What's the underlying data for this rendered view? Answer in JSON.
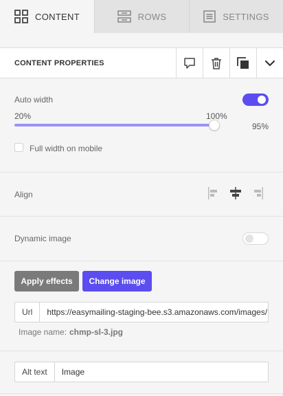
{
  "tabs": [
    {
      "label": "CONTENT",
      "icon": "grid-icon",
      "active": true
    },
    {
      "label": "ROWS",
      "icon": "rows-icon",
      "active": false
    },
    {
      "label": "SETTINGS",
      "icon": "settings-list-icon",
      "active": false
    }
  ],
  "header": {
    "title": "CONTENT PROPERTIES",
    "actions": [
      "comment-icon",
      "trash-icon",
      "duplicate-icon",
      "chevron-down-icon"
    ]
  },
  "auto_width": {
    "label": "Auto width",
    "enabled": true,
    "slider_min": "20%",
    "slider_max": "100%",
    "current": "95%",
    "slider_fraction": 0.95
  },
  "full_width_mobile": {
    "label": "Full width on mobile",
    "checked": false
  },
  "align": {
    "label": "Align",
    "options": [
      "align-left-icon",
      "align-center-icon",
      "align-right-icon"
    ],
    "selected": "center"
  },
  "dynamic_image": {
    "label": "Dynamic image",
    "enabled": false
  },
  "buttons": {
    "apply": "Apply effects",
    "change": "Change image"
  },
  "url": {
    "label": "Url",
    "value": "https://easymailing-staging-bee.s3.amazonaws.com/images/"
  },
  "image_name": {
    "label": "Image name:",
    "value": "chmp-sl-3.jpg"
  },
  "alt_text": {
    "label": "Alt text",
    "value": "Image"
  },
  "colors": {
    "accent": "#5b4df0",
    "muted_button": "#7a7a7a"
  }
}
